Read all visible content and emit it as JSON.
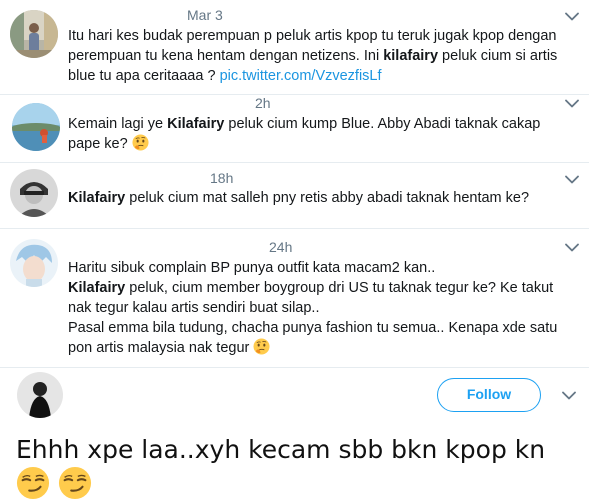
{
  "tweets": [
    {
      "time": "Mar 3",
      "segments": [
        {
          "text": "Itu hari kes budak perempuan p peluk artis kpop tu teruk jugak kpop dengan perempuan tu kena hentam dengan netizens. Ini ",
          "style": "normal"
        },
        {
          "text": "kilafairy",
          "style": "bold"
        },
        {
          "text": " peluk cium si artis blue tu apa ceritaaaa ? ",
          "style": "normal"
        },
        {
          "text": "pic.twitter.com/VzvezfisLf",
          "style": "link"
        }
      ]
    },
    {
      "time": "2h",
      "segments": [
        {
          "text": "Kemain lagi ye ",
          "style": "normal"
        },
        {
          "text": "Kilafairy",
          "style": "bold"
        },
        {
          "text": " peluk cium kump Blue. Abby Abadi taknak cakap pape ke? ",
          "style": "normal"
        },
        {
          "text": "thinking-face-emoji",
          "style": "emoji"
        }
      ]
    },
    {
      "time": "18h",
      "segments": [
        {
          "text": "Kilafairy",
          "style": "bold"
        },
        {
          "text": " peluk cium mat salleh pny retis abby abadi taknak hentam ke?",
          "style": "normal"
        }
      ]
    },
    {
      "time": "24h",
      "segments": [
        {
          "text": "Haritu sibuk complain BP punya outfit kata macam2 kan..",
          "style": "normal"
        },
        {
          "text": "\n",
          "style": "break"
        },
        {
          "text": "Kilafairy",
          "style": "bold"
        },
        {
          "text": " peluk, cium member boygroup dri US tu taknak tegur ke? Ke takut nak tegur kalau artis sendiri buat silap..",
          "style": "normal"
        },
        {
          "text": "\n",
          "style": "break"
        },
        {
          "text": "Pasal emma bila tudung, chacha punya fashion tu semua.. Kenapa xde satu pon artis malaysia nak tegur ",
          "style": "normal"
        },
        {
          "text": "thinking-face-emoji",
          "style": "emoji"
        }
      ]
    }
  ],
  "follow_label": "Follow",
  "comment": {
    "text": "Ehhh xpe laa..xyh kecam sbb bkn kpop kn ",
    "emoji": "smirking-face-emoji"
  },
  "colors": {
    "link": "#1b95e0",
    "follow": "#1da1f2",
    "meta": "#657786",
    "divider": "#e6ecf0"
  }
}
